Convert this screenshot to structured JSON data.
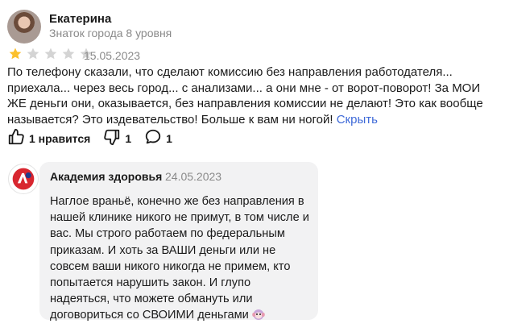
{
  "review": {
    "author": "Екатерина",
    "level": "Знаток города 8 уровня",
    "rating": 1,
    "rating_max": 5,
    "date": "15.05.2023",
    "text": "По телефону сказали, что сделают комиссию без направления работодателя... приехала... через весь город... с анализами... а они мне - от ворот-поворот! За МОИ ЖЕ деньги они, оказывается, без направления комиссии не делают! Это как вообще называется? Это издевательство! Больше к вам ни ногой!",
    "collapse_label": "Скрыть",
    "likes_label": "1 нравится",
    "dislikes": "1",
    "comments": "1"
  },
  "reply": {
    "org_name": "Академия здоровья",
    "date": "24.05.2023",
    "text": "Наглое враньё, конечно же без направления в нашей клинике никого не примут, в том числе и вас. Мы строго работаем по федеральным приказам. И хоть за ВАШИ деньги или не совсем ваши никого никогда не примем, кто попытается нарушить закон. И глупо надеяться, что можете обмануть или договориться со СВОИМИ деньгами"
  },
  "colors": {
    "star_filled": "#fbc02d",
    "star_empty": "#d4d4d4",
    "link": "#3f6ad8",
    "logo_red": "#d8262f",
    "logo_blue": "#1d3c8c"
  },
  "icons": {
    "like": "thumb-up-icon",
    "dislike": "thumb-down-icon",
    "comment": "comment-bubble-icon",
    "reply_emoji": "hear-no-evil-monkey-emoji"
  }
}
